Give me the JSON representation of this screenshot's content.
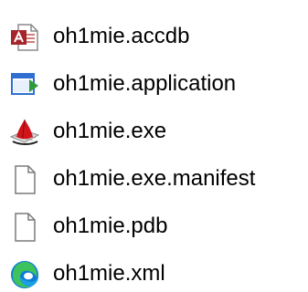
{
  "files": [
    {
      "name": "oh1mie.accdb",
      "icon": "access-database-icon"
    },
    {
      "name": "oh1mie.application",
      "icon": "application-manifest-icon"
    },
    {
      "name": "oh1mie.exe",
      "icon": "executable-app-icon"
    },
    {
      "name": "oh1mie.exe.manifest",
      "icon": "blank-document-icon"
    },
    {
      "name": "oh1mie.pdb",
      "icon": "blank-document-icon"
    },
    {
      "name": "oh1mie.xml",
      "icon": "edge-browser-icon"
    }
  ],
  "colors": {
    "text": "#000000",
    "access_red": "#a4262c",
    "app_blue": "#2f6fd1",
    "app_green": "#2e9b3a",
    "exe_red": "#d0141a",
    "edge_blue": "#0c7bd6",
    "edge_green": "#3ec25e",
    "doc_outline": "#7a7a7a"
  }
}
